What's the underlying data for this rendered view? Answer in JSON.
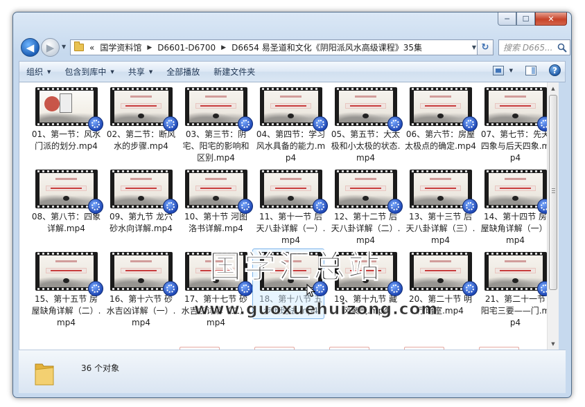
{
  "window": {
    "controls": {
      "minimize": "─",
      "maximize": "☐",
      "close": "✕"
    }
  },
  "navigation": {
    "back": "◀",
    "forward": "▶",
    "breadcrumb_overflow": "«",
    "breadcrumb": [
      "国学资料馆",
      "D6601-D6700",
      "D6654 易圣道和文化《阴阳派风水高级课程》35集"
    ],
    "search_placeholder": "搜索 D665..."
  },
  "toolbar": {
    "organize": "组织",
    "include_in_library": "包含到库中",
    "share": "共享",
    "play_all": "全部播放",
    "new_folder": "新建文件夹",
    "help": "?"
  },
  "files": [
    {
      "label": "01、第一节：风水门派的划分.mp4"
    },
    {
      "label": "02、第二节：断风水的步骤.mp4"
    },
    {
      "label": "03、第三节：阴宅、阳宅的影响和区别.mp4"
    },
    {
      "label": "04、第四节：学习风水具备的能力.mp4"
    },
    {
      "label": "05、第五节：大太极和小太极的状态.mp4"
    },
    {
      "label": "06、第六节：房屋太极点的确定.mp4"
    },
    {
      "label": "07、第七节：先天四象与后天四象.mp4"
    },
    {
      "label": "08、第八节：四象详解.mp4"
    },
    {
      "label": "09、第九节 龙穴砂水向详解.mp4"
    },
    {
      "label": "10、第十节 河图洛书详解.mp4"
    },
    {
      "label": "11、第十一节 后天八卦详解（一）.mp4"
    },
    {
      "label": "12、第十二节 后天八卦详解（二）.mp4"
    },
    {
      "label": "13、第十三节 后天八卦详解（三）.mp4"
    },
    {
      "label": "14、第十四节 房屋缺角详解（一）.mp4"
    },
    {
      "label": "15、第十五节 房屋缺角详解（二）.mp4"
    },
    {
      "label": "16、第十六节 砂水吉凶详解（一）.mp4"
    },
    {
      "label": "17、第十七节 砂水吉凶详解（二）.mp4"
    },
    {
      "label": "18、第十八节 五步地理法.mp4",
      "selected": true
    },
    {
      "label": "19、第十九节 藏风聚气.mp4"
    },
    {
      "label": "20、第二十节 明厅暗室.mp4"
    },
    {
      "label": "21、第二十一节 阳宅三要——门.mp4"
    }
  ],
  "watermark": {
    "title": "国学汇总站",
    "url": "www.guoxuehuizong.com"
  },
  "status": {
    "count": "36 个对象"
  }
}
